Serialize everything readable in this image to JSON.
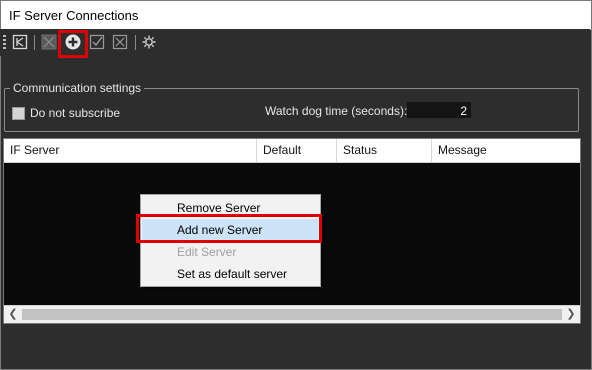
{
  "window": {
    "title": "IF Server Connections"
  },
  "toolbar": {
    "buttons": [
      {
        "icon": "import-icon"
      },
      {
        "icon": "remove-server-icon"
      },
      {
        "icon": "add-server-icon"
      },
      {
        "icon": "edit-server-icon"
      },
      {
        "icon": "set-default-icon"
      },
      {
        "icon": "settings-icon"
      }
    ]
  },
  "communication": {
    "legend": "Communication settings",
    "do_not_subscribe_label": "Do not subscribe",
    "watchdog_label": "Watch dog time (seconds):",
    "watchdog_value": "2"
  },
  "list": {
    "columns": [
      "IF Server",
      "Default",
      "Status",
      "Message"
    ]
  },
  "context_menu": {
    "items": [
      {
        "label": "Remove Server",
        "enabled": true
      },
      {
        "label": "Add new Server",
        "enabled": true,
        "selected": true
      },
      {
        "label": "Edit Server",
        "enabled": false
      },
      {
        "label": "Set as default server",
        "enabled": true
      }
    ]
  },
  "colors": {
    "highlight": "#e00000",
    "menu_selection": "#cde3f7"
  }
}
